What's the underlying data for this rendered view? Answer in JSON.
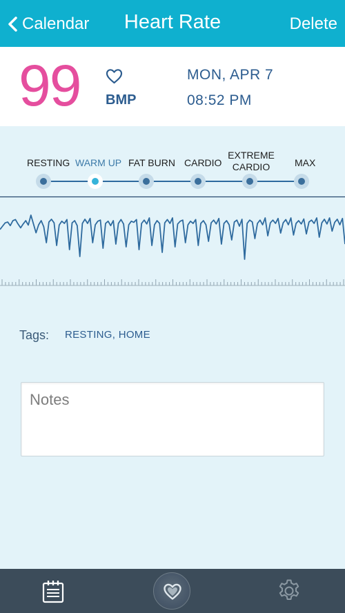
{
  "topbar": {
    "back_label": "Calendar",
    "title": "Heart Rate",
    "delete_label": "Delete",
    "color": "#0fb0cf"
  },
  "reading": {
    "value": "99",
    "unit": "BMP",
    "date": "MON, APR 7",
    "time": "08:52 PM",
    "value_color": "#e54e9e"
  },
  "zones": {
    "items": [
      {
        "label": "RESTING",
        "label2": ""
      },
      {
        "label": "WARM UP",
        "label2": ""
      },
      {
        "label": "FAT BURN",
        "label2": ""
      },
      {
        "label": "CARDIO",
        "label2": ""
      },
      {
        "label": "EXTREME",
        "label2": "CARDIO"
      },
      {
        "label": "MAX",
        "label2": ""
      }
    ],
    "selected": "WARM UP"
  },
  "waveform": {
    "type": "line",
    "color": "#2e6a9e",
    "series": [
      {
        "values": [
          0.72,
          0.6,
          0.48,
          0.45,
          0.58,
          0.4,
          0.36,
          0.52,
          0.66,
          0.52,
          0.4,
          0.56,
          0.2,
          0.52,
          0.84,
          0.55,
          0.4,
          0.62,
          1.2,
          0.45,
          0.35,
          0.48,
          1.3,
          0.56,
          0.42,
          0.5,
          0.36,
          1.45,
          0.48,
          0.4,
          0.58,
          1.7,
          0.5,
          0.35,
          0.5,
          0.32,
          1.2,
          0.55,
          0.42,
          0.38,
          1.4,
          0.5,
          0.42,
          0.58,
          0.4,
          1.25,
          0.5,
          0.36,
          0.52,
          1.35,
          0.55,
          0.42,
          0.46,
          0.36,
          1.45,
          0.5,
          0.38,
          0.52,
          0.3,
          1.3,
          0.55,
          0.4,
          0.5,
          1.55,
          0.48,
          0.36,
          0.5,
          0.3,
          1.35,
          0.52,
          0.42,
          0.38,
          1.2,
          0.55,
          0.42,
          0.5,
          0.36,
          1.3,
          0.5,
          0.4,
          0.55,
          1.15,
          0.48,
          0.38,
          0.52,
          0.32,
          1.25,
          0.5,
          0.4,
          0.55,
          1.1,
          0.45,
          0.38,
          0.6,
          0.35,
          1.8,
          0.5,
          0.38,
          0.45,
          1.05,
          0.5,
          0.38,
          0.55,
          0.3,
          0.95,
          0.48,
          0.38,
          0.5,
          0.32,
          0.85,
          0.48,
          0.36,
          0.55,
          0.3,
          0.92,
          0.5,
          0.4,
          0.52,
          0.34,
          0.88,
          0.45,
          0.38,
          0.5,
          0.3,
          1.0,
          0.48,
          0.35,
          0.52,
          0.3,
          0.78,
          0.46,
          0.35,
          0.55,
          0.32,
          1.25
        ]
      }
    ]
  },
  "tags": {
    "label": "Tags:",
    "value": "RESTING, HOME"
  },
  "notes": {
    "placeholder": "Notes",
    "value": ""
  },
  "bottombar": {
    "color": "#3c4c5a",
    "tabs": [
      {
        "icon": "calendar-list-icon"
      },
      {
        "icon": "heart-icon"
      },
      {
        "icon": "gear-icon"
      }
    ]
  }
}
